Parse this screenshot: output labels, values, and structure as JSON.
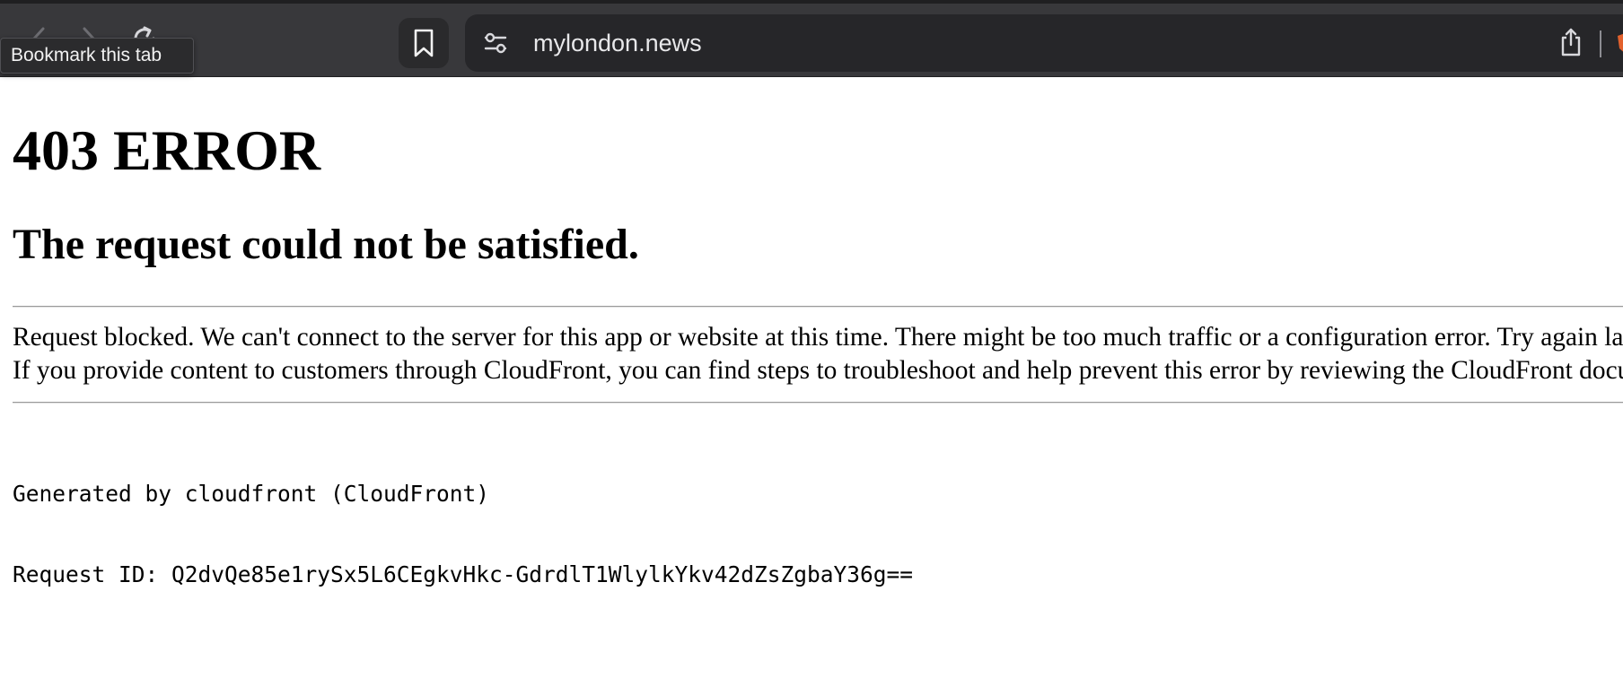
{
  "browser": {
    "tooltip": "Bookmark this tab",
    "url": "mylondon.news",
    "icons": {
      "back": "chevron-left-icon",
      "forward": "chevron-right-icon",
      "reload": "reload-icon",
      "bookmark": "bookmark-icon",
      "site_settings": "sliders-icon",
      "share": "share-icon",
      "extension": "brave-shield-icon"
    },
    "colors": {
      "toolbar": "#38383b",
      "addressbar": "#262629",
      "url_text": "#e8e8ea",
      "extension_accent": "#e2612d"
    }
  },
  "page": {
    "heading": "403 ERROR",
    "subheading": "The request could not be satisfied.",
    "message_line_1": "Request blocked. We can't connect to the server for this app or website at this time. There might be too much traffic or a configuration error. Try again later, or contact the app or website owner.",
    "message_line_2": "If you provide content to customers through CloudFront, you can find steps to troubleshoot and help prevent this error by reviewing the CloudFront documentation.",
    "generated_by": "Generated by cloudfront (CloudFront)",
    "request_id": "Request ID: Q2dvQe85e1rySx5L6CEgkvHkc-GdrdlT1WlylkYkv42dZsZgbaY36g=="
  }
}
